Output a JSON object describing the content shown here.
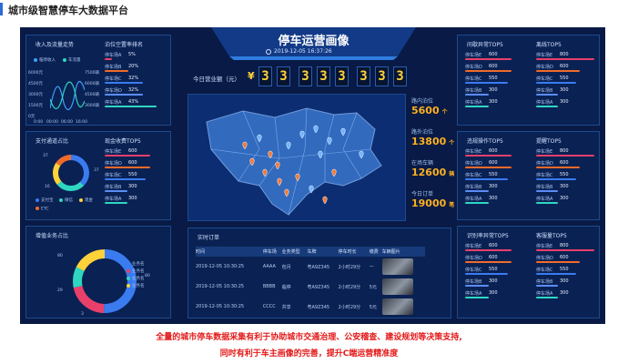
{
  "slide_title": "城市级智慧停车大数据平台",
  "header": {
    "title": "停车运营画像",
    "datetime": "2019-12-05  16:37:26"
  },
  "revenue": {
    "label": "今日营业额（元）",
    "currency": "¥",
    "digits": [
      "3",
      "3",
      "3",
      "3",
      "3",
      "3",
      "3",
      "3"
    ]
  },
  "left_top": {
    "title": "收入及流量走势",
    "legend": [
      "临停收入",
      "车流量"
    ],
    "y_ticks": [
      "6000元",
      "4500元",
      "3000元",
      "1500元",
      "0元"
    ],
    "y_ticks_right": [
      "7500辆",
      "6000辆",
      "4500辆",
      "3000辆"
    ],
    "x_ticks": [
      "0:00",
      "00:00",
      "06:00",
      "16:00"
    ],
    "sub_title": "泊位空置率排名",
    "items": [
      {
        "label": "停车场A",
        "value": "5%"
      },
      {
        "label": "停车场B",
        "value": "20%"
      },
      {
        "label": "停车场C",
        "value": "32%"
      },
      {
        "label": "停车场D",
        "value": "32%"
      },
      {
        "label": "停车场A",
        "value": "43%"
      }
    ]
  },
  "left_mid": {
    "title": "支付通道占比",
    "legend": [
      "支付宝",
      "微信",
      "现金",
      "ETC"
    ],
    "labels": [
      "37",
      "37",
      "16"
    ],
    "sub_title": "现金收费TOP5",
    "items": [
      {
        "label": "停车场E",
        "value": "600"
      },
      {
        "label": "停车场D",
        "value": "600"
      },
      {
        "label": "停车场C",
        "value": "550"
      },
      {
        "label": "停车场B",
        "value": "300"
      },
      {
        "label": "停车场A",
        "value": "300"
      }
    ]
  },
  "left_bot": {
    "title": "增值业务占比",
    "legend": [
      "业务名",
      "业务名",
      "业务名",
      "业务名"
    ],
    "labels": [
      "80",
      "29",
      "3",
      "80"
    ]
  },
  "stats": [
    {
      "label": "路内泊位",
      "value": "5600",
      "unit": "个"
    },
    {
      "label": "路外泊位",
      "value": "13800",
      "unit": "个"
    },
    {
      "label": "在场车辆",
      "value": "12600",
      "unit": "辆"
    },
    {
      "label": "今日订单",
      "value": "19000",
      "unit": "笔"
    }
  ],
  "orders": {
    "title": "实时订单",
    "columns": [
      "时间",
      "停车场",
      "业务类型",
      "车牌",
      "停车时长",
      "缴费",
      "车辆图片"
    ],
    "rows": [
      {
        "time": "2019-12-05 10:30:25",
        "lot": "AAAA",
        "type": "包月",
        "plate": "粤A9Z345",
        "duration": "2小时29分",
        "fee": "—"
      },
      {
        "time": "2019-12-05 10:30:25",
        "lot": "BBBB",
        "type": "临停",
        "plate": "粤A9Z345",
        "duration": "2小时29分",
        "fee": "5元"
      },
      {
        "time": "2019-12-05 10:30:25",
        "lot": "CCCC",
        "type": "共享",
        "plate": "粤A9Z345",
        "duration": "2小时29分",
        "fee": "5元"
      }
    ]
  },
  "right": [
    {
      "title": "间歇异常TOP5",
      "sub_title": "离线TOP5",
      "a": [
        {
          "label": "停车场E",
          "value": "600"
        },
        {
          "label": "停车场D",
          "value": "600"
        },
        {
          "label": "停车场C",
          "value": "550"
        },
        {
          "label": "停车场B",
          "value": "300"
        },
        {
          "label": "停车场A",
          "value": "300"
        }
      ],
      "b": [
        {
          "label": "停车场E",
          "value": "800"
        },
        {
          "label": "停车场D",
          "value": "600"
        },
        {
          "label": "停车场C",
          "value": "550"
        },
        {
          "label": "停车场B",
          "value": "300"
        },
        {
          "label": "停车场A",
          "value": "300"
        }
      ]
    },
    {
      "title": "违规操作TOP5",
      "sub_title": "提醒TOP5",
      "a": [
        {
          "label": "停车场E",
          "value": "600"
        },
        {
          "label": "停车场D",
          "value": "600"
        },
        {
          "label": "停车场C",
          "value": "550"
        },
        {
          "label": "停车场B",
          "value": "300"
        },
        {
          "label": "停车场A",
          "value": "300"
        }
      ],
      "b": [
        {
          "label": "停车场E",
          "value": "800"
        },
        {
          "label": "停车场D",
          "value": "600"
        },
        {
          "label": "停车场C",
          "value": "550"
        },
        {
          "label": "停车场B",
          "value": "300"
        },
        {
          "label": "停车场A",
          "value": "300"
        }
      ]
    },
    {
      "title": "识别率异常TOP5",
      "sub_title": "客服量TOP5",
      "a": [
        {
          "label": "停车场E",
          "value": "600"
        },
        {
          "label": "停车场D",
          "value": "600"
        },
        {
          "label": "停车场C",
          "value": "550"
        },
        {
          "label": "停车场B",
          "value": "300"
        },
        {
          "label": "停车场A",
          "value": "300"
        }
      ],
      "b": [
        {
          "label": "停车场E",
          "value": "800"
        },
        {
          "label": "停车场D",
          "value": "600"
        },
        {
          "label": "停车场C",
          "value": "550"
        },
        {
          "label": "停车场B",
          "value": "300"
        },
        {
          "label": "停车场A",
          "value": "300"
        }
      ]
    }
  ],
  "caption": [
    "全量的城市停车数据采集有利于协助城市交通治理、公安稽查、建设规划等决策支持,",
    "同时有利于车主画像的完善，提升C端运营精准度"
  ],
  "colors": {
    "bg": "#081a45",
    "panel_border": "#1d4a8c",
    "accent": "#ffd23a",
    "caption": "#e31818"
  }
}
